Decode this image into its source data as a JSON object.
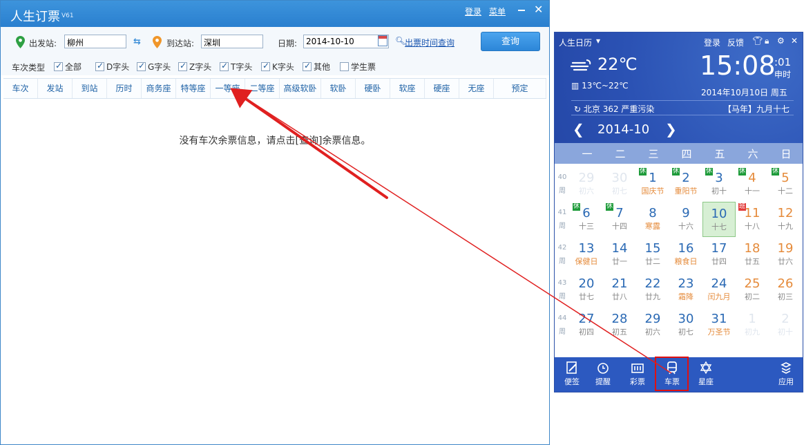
{
  "ticket_window": {
    "title": "人生订票",
    "version": "V61",
    "login": "登录",
    "menu": "菜单",
    "depart_label": "出发站:",
    "depart_value": "柳州",
    "arrive_label": "到达站:",
    "arrive_value": "深圳",
    "date_label": "日期:",
    "date_value": "2014-10-10",
    "time_query_link": "出票时间查询",
    "query_button": "查询",
    "train_type_label": "车次类型",
    "filters": [
      {
        "label": "全部",
        "checked": true
      },
      {
        "label": "D字头",
        "checked": true
      },
      {
        "label": "G字头",
        "checked": true
      },
      {
        "label": "Z字头",
        "checked": true
      },
      {
        "label": "T字头",
        "checked": true
      },
      {
        "label": "K字头",
        "checked": true
      },
      {
        "label": "其他",
        "checked": true
      },
      {
        "label": "学生票",
        "checked": false
      }
    ],
    "columns": [
      "车次",
      "发站",
      "到站",
      "历时",
      "商务座",
      "特等座",
      "一等座",
      "二等座",
      "高级软卧",
      "软卧",
      "硬卧",
      "软座",
      "硬座",
      "无座",
      "预定"
    ],
    "empty_message": "没有车次余票信息，请点击[查询]余票信息。"
  },
  "calendar": {
    "app_name": "人生日历",
    "login": "登录",
    "feedback": "反馈",
    "temperature": "22℃",
    "temp_range": "13℃~22℃",
    "time": "15:08",
    "seconds": ":01",
    "shichen": "申时",
    "date_line": "2014年10月10日 周五",
    "aqi": "北京 362 严重污染",
    "lunar": "【马年】九月十七",
    "month": "2014-10",
    "weekdays": [
      "一",
      "二",
      "三",
      "四",
      "五",
      "六",
      "日"
    ],
    "weeks": [
      {
        "num": "40",
        "label": "周",
        "days": [
          {
            "n": "29",
            "l": "初六",
            "dim": true
          },
          {
            "n": "30",
            "l": "初七",
            "dim": true
          },
          {
            "n": "1",
            "l": "国庆节",
            "fest": true,
            "tag": "休"
          },
          {
            "n": "2",
            "l": "重阳节",
            "fest": true,
            "tag": "休"
          },
          {
            "n": "3",
            "l": "初十",
            "tag": "休"
          },
          {
            "n": "4",
            "l": "十一",
            "we": true,
            "tag": "休"
          },
          {
            "n": "5",
            "l": "十二",
            "we": true,
            "tag": "休"
          }
        ]
      },
      {
        "num": "41",
        "label": "周",
        "days": [
          {
            "n": "6",
            "l": "十三",
            "tag": "休"
          },
          {
            "n": "7",
            "l": "十四",
            "tag": "休"
          },
          {
            "n": "8",
            "l": "寒露",
            "fest": true
          },
          {
            "n": "9",
            "l": "十六"
          },
          {
            "n": "10",
            "l": "十七",
            "today": true
          },
          {
            "n": "11",
            "l": "十八",
            "we": true,
            "tag": "班"
          },
          {
            "n": "12",
            "l": "十九",
            "we": true
          }
        ]
      },
      {
        "num": "42",
        "label": "周",
        "days": [
          {
            "n": "13",
            "l": "保健日",
            "fest": true
          },
          {
            "n": "14",
            "l": "廿一"
          },
          {
            "n": "15",
            "l": "廿二"
          },
          {
            "n": "16",
            "l": "粮食日",
            "fest": true
          },
          {
            "n": "17",
            "l": "廿四"
          },
          {
            "n": "18",
            "l": "廿五",
            "we": true
          },
          {
            "n": "19",
            "l": "廿六",
            "we": true
          }
        ]
      },
      {
        "num": "43",
        "label": "周",
        "days": [
          {
            "n": "20",
            "l": "廿七"
          },
          {
            "n": "21",
            "l": "廿八"
          },
          {
            "n": "22",
            "l": "廿九"
          },
          {
            "n": "23",
            "l": "霜降",
            "fest": true
          },
          {
            "n": "24",
            "l": "闰九月",
            "fest": true
          },
          {
            "n": "25",
            "l": "初二",
            "we": true
          },
          {
            "n": "26",
            "l": "初三",
            "we": true
          }
        ]
      },
      {
        "num": "44",
        "label": "周",
        "days": [
          {
            "n": "27",
            "l": "初四"
          },
          {
            "n": "28",
            "l": "初五"
          },
          {
            "n": "29",
            "l": "初六"
          },
          {
            "n": "30",
            "l": "初七"
          },
          {
            "n": "31",
            "l": "万圣节",
            "fest": true
          },
          {
            "n": "1",
            "l": "初九",
            "dim": true
          },
          {
            "n": "2",
            "l": "初十",
            "dim": true
          }
        ]
      }
    ],
    "toolbar": [
      {
        "label": "便签",
        "icon": "note-icon"
      },
      {
        "label": "提醒",
        "icon": "alarm-icon"
      },
      {
        "label": "彩票",
        "icon": "lottery-icon"
      },
      {
        "label": "车票",
        "icon": "train-icon"
      },
      {
        "label": "星座",
        "icon": "star-icon"
      },
      {
        "label": "应用",
        "icon": "apps-icon"
      }
    ]
  },
  "colors": {
    "title_bar": "#2a7fcf",
    "highlight_box": "#e01010",
    "arrow": "#e02020",
    "calendar_header": "#2b52b4"
  }
}
